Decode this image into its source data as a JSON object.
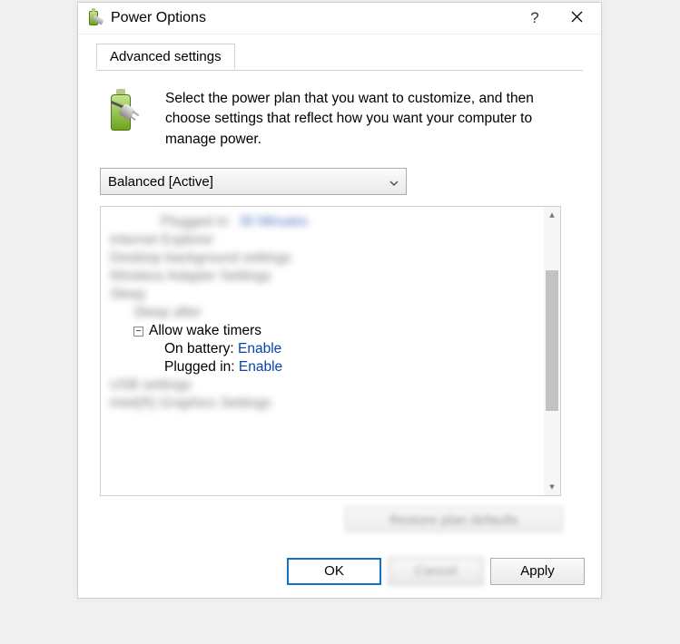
{
  "titlebar": {
    "title": "Power Options"
  },
  "tab_label": "Advanced settings",
  "intro": "Select the power plan that you want to customize, and then choose settings that reflect how you want your computer to manage power.",
  "combo_selected": "Balanced [Active]",
  "tree": {
    "blur_plugged": "Plugged in:",
    "blur_plugged_val": "30 Minutes",
    "blur_ie": "Internet Explorer",
    "blur_desktop": "Desktop background settings",
    "blur_wifi": "Wireless Adapter Settings",
    "blur_sleep": "Sleep",
    "blur_sleep_after": "Sleep after",
    "allow_wake_timers": "Allow wake timers",
    "on_battery_label": "On battery:",
    "on_battery_val": "Enable",
    "plugged_in_label": "Plugged in:",
    "plugged_in_val": "Enable",
    "blur_usb": "USB settings",
    "blur_intel": "Intel(R) Graphics Settings"
  },
  "restore_label": "Restore plan defaults",
  "buttons": {
    "ok": "OK",
    "cancel": "Cancel",
    "apply": "Apply"
  }
}
